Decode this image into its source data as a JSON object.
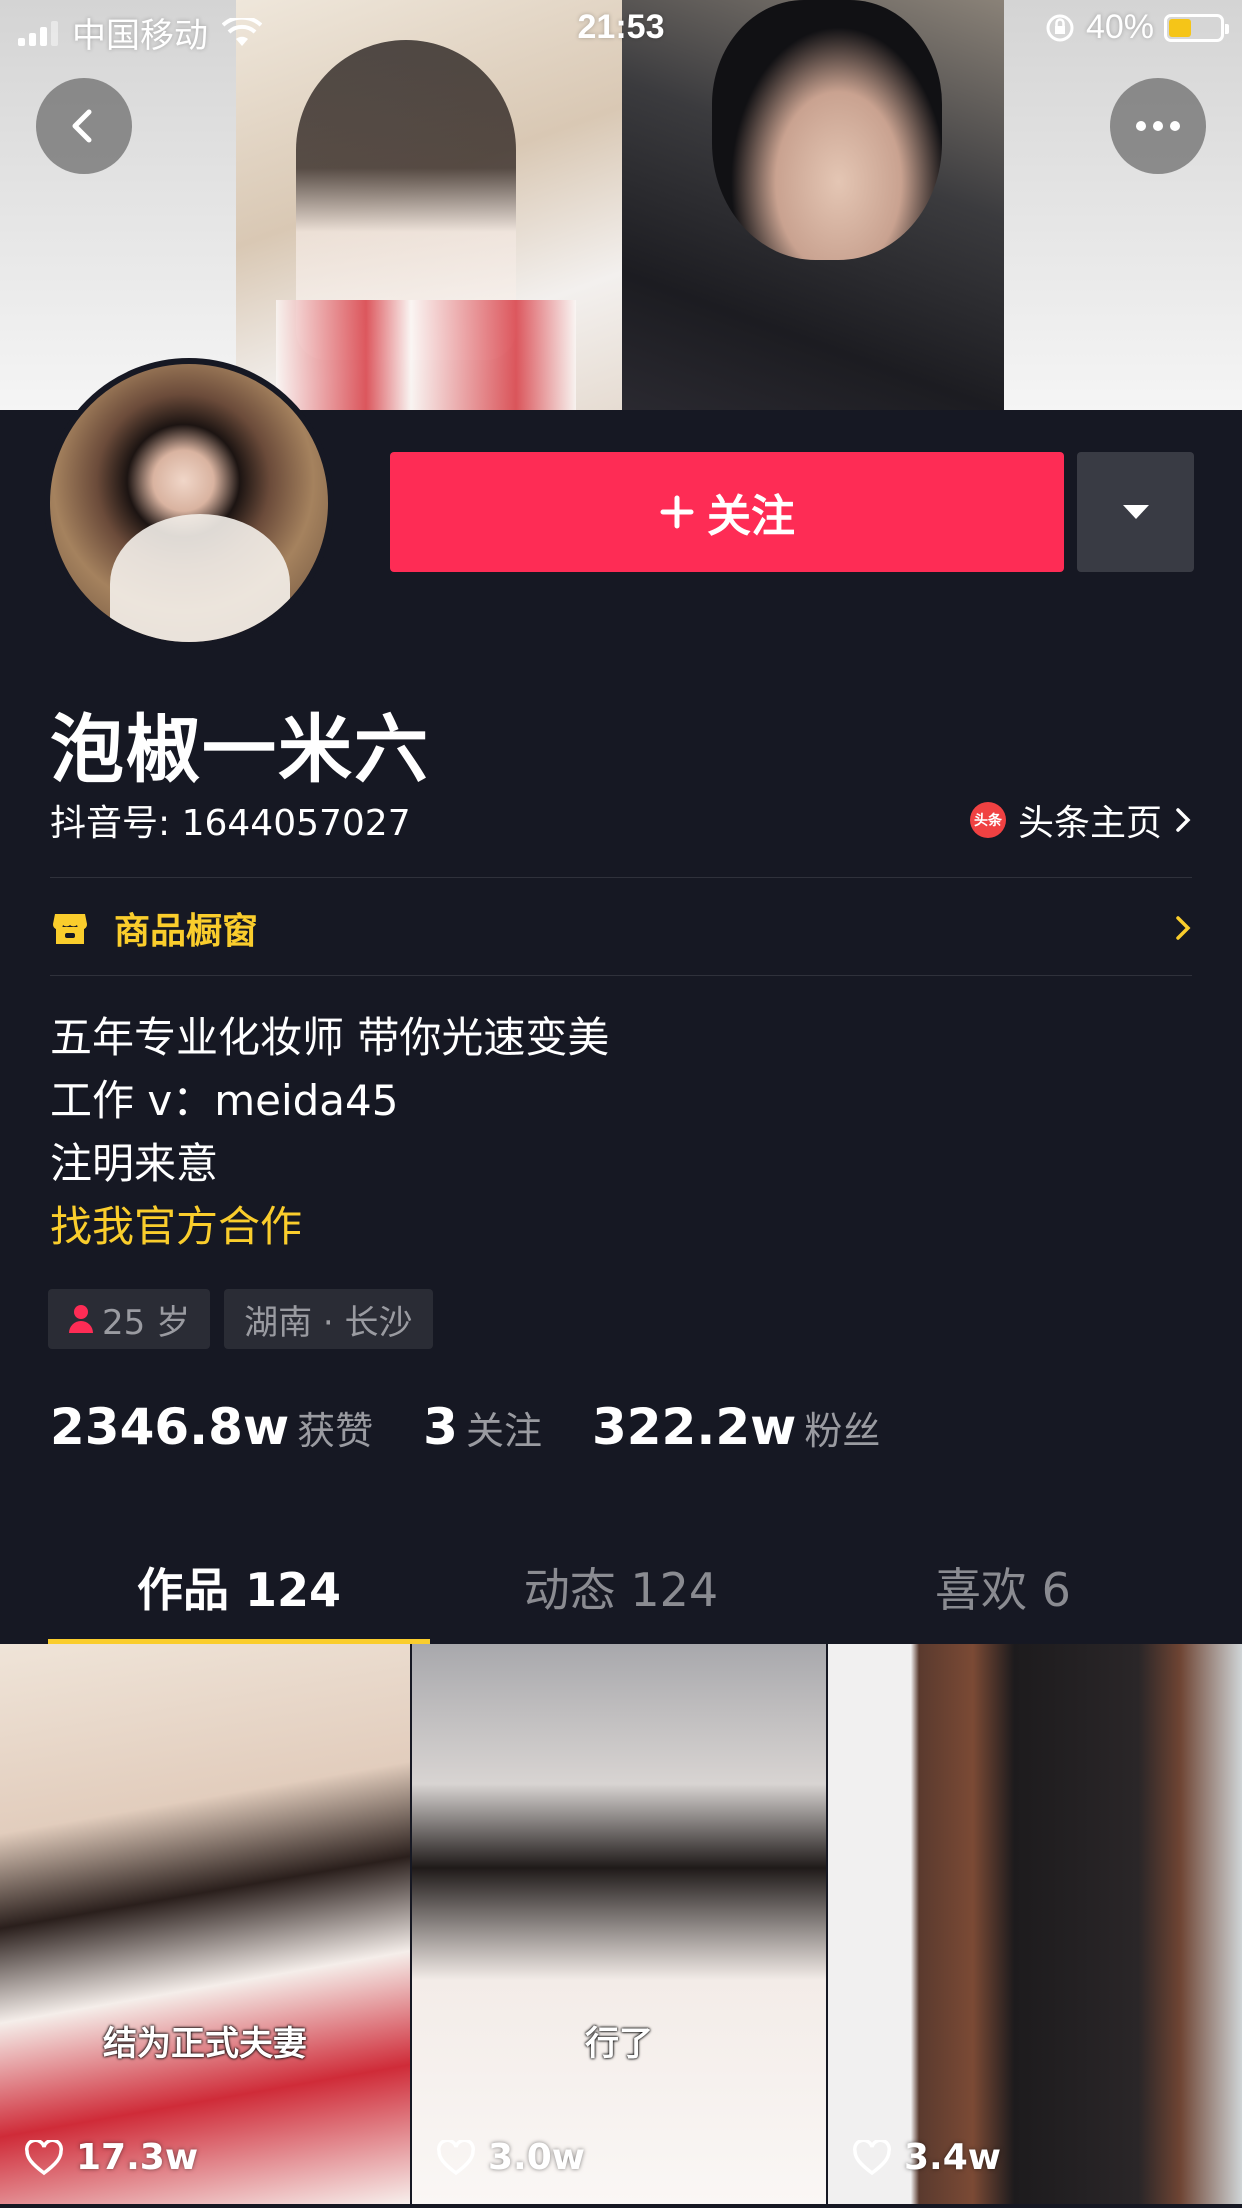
{
  "status_bar": {
    "carrier": "中国移动",
    "time": "21:53",
    "battery": "40%"
  },
  "profile": {
    "follow_label": "关注",
    "name": "泡椒一米六",
    "douyin_id": "抖音号: 1644057027",
    "toutiao_logo": "头条",
    "toutiao_label": "头条主页",
    "shop_label": "商品橱窗",
    "bio": [
      "五年专业化妆师 带你光速变美",
      "工作 v：meida45",
      "注明来意"
    ],
    "bio_link": "找我官方合作",
    "tags": {
      "age": "25 岁",
      "location": "湖南 · 长沙"
    },
    "stats": [
      {
        "num": "2346.8w",
        "label": "获赞"
      },
      {
        "num": "3",
        "label": "关注"
      },
      {
        "num": "322.2w",
        "label": "粉丝"
      }
    ]
  },
  "tabs": [
    {
      "label": "作品 124",
      "active": true
    },
    {
      "label": "动态 124",
      "active": false
    },
    {
      "label": "喜欢 6",
      "active": false
    }
  ],
  "videos": [
    {
      "caption": "结为正式夫妻",
      "likes": "17.3w"
    },
    {
      "caption": "行了",
      "likes": "3.0w"
    },
    {
      "caption": "",
      "likes": "3.4w"
    }
  ],
  "colors": {
    "background": "#161823",
    "accent_red": "#fe2c55",
    "accent_yellow": "#facd2c"
  },
  "icons": [
    "back-icon",
    "more-icon",
    "plus-icon",
    "caret-down-icon",
    "toutiao-logo",
    "chevron-right-icon",
    "shop-icon",
    "female-icon",
    "heart-icon"
  ]
}
